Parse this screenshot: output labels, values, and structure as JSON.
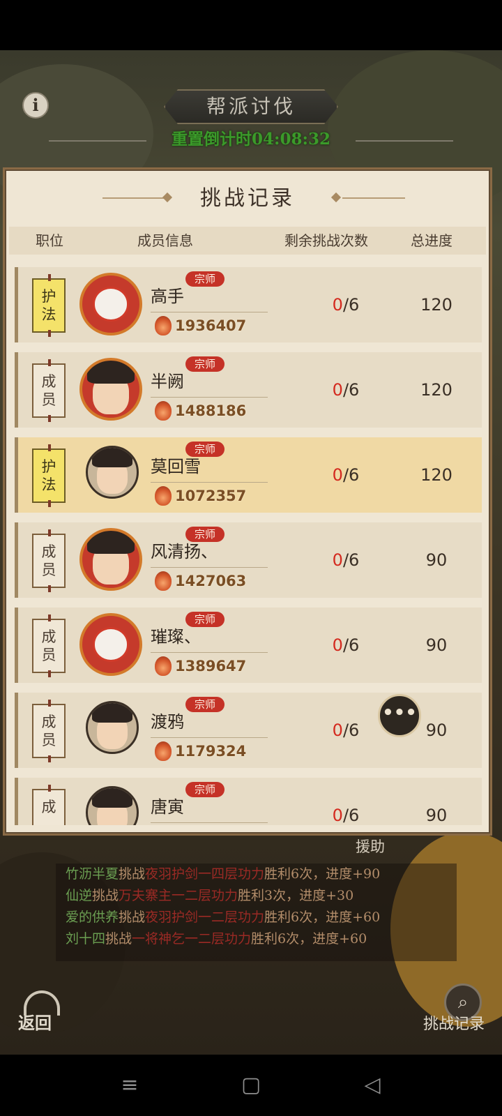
{
  "header": {
    "title": "帮派讨伐",
    "countdown": "重置倒计时04:08:32",
    "info_icon": "info-icon"
  },
  "panel": {
    "title": "挑战记录",
    "columns": [
      "职位",
      "成员信息",
      "剩余挑战次数",
      "总进度"
    ]
  },
  "members": [
    {
      "position": "护法",
      "badge": "宗师",
      "name": "高手",
      "power": "1936407",
      "used": "0",
      "total": "/6",
      "progress": "120",
      "avatar": "lion",
      "highlight": false
    },
    {
      "position": "成员",
      "badge": "宗师",
      "name": "半阙",
      "power": "1488186",
      "used": "0",
      "total": "/6",
      "progress": "120",
      "avatar": "festive",
      "highlight": false
    },
    {
      "position": "护法",
      "badge": "宗师",
      "name": "莫回雪",
      "power": "1072357",
      "used": "0",
      "total": "/6",
      "progress": "120",
      "avatar": "plain",
      "highlight": true
    },
    {
      "position": "成员",
      "badge": "宗师",
      "name": "风清扬、",
      "power": "1427063",
      "used": "0",
      "total": "/6",
      "progress": "90",
      "avatar": "festive",
      "highlight": false
    },
    {
      "position": "成员",
      "badge": "宗师",
      "name": "璀璨、",
      "power": "1389647",
      "used": "0",
      "total": "/6",
      "progress": "90",
      "avatar": "lion",
      "highlight": false
    },
    {
      "position": "成员",
      "badge": "宗师",
      "name": "渡鸦",
      "power": "1179324",
      "used": "0",
      "total": "/6",
      "progress": "90",
      "avatar": "plain",
      "highlight": false
    },
    {
      "position": "成",
      "badge": "宗师",
      "name": "唐寅",
      "power": "",
      "used": "0",
      "total": "/6",
      "progress": "90",
      "avatar": "plain",
      "highlight": false
    }
  ],
  "chat": {
    "icon": "chat-bubble-icon",
    "glyph": "•••"
  },
  "help_label": "援助",
  "log": [
    {
      "player": "竹沥半夏",
      "verb": "挑战",
      "target": "夜羽护剑一四层功力",
      "result": "胜利6次，进度+90"
    },
    {
      "player": "仙逆",
      "verb": "挑战",
      "target": "万夫寨主一二层功力",
      "result": "胜利3次，进度+30"
    },
    {
      "player": "爱的供养",
      "verb": "挑战",
      "target": "夜羽护剑一二层功力",
      "result": "胜利6次，进度+60"
    },
    {
      "player": "刘十四",
      "verb": "挑战",
      "target": "一将神乞一二层功力",
      "result": "胜利6次，进度+60"
    }
  ],
  "footer": {
    "back_label": "返回",
    "record_label": "挑战记录"
  },
  "nav": {
    "menu_icon": "≡",
    "home_icon": "▢",
    "back_icon": "◁"
  },
  "colors": {
    "accent_red": "#d42a1f",
    "countdown_green": "#3b9a2a",
    "highlight_row": "#f0d9a4",
    "gold_tag": "#f4e26a"
  }
}
